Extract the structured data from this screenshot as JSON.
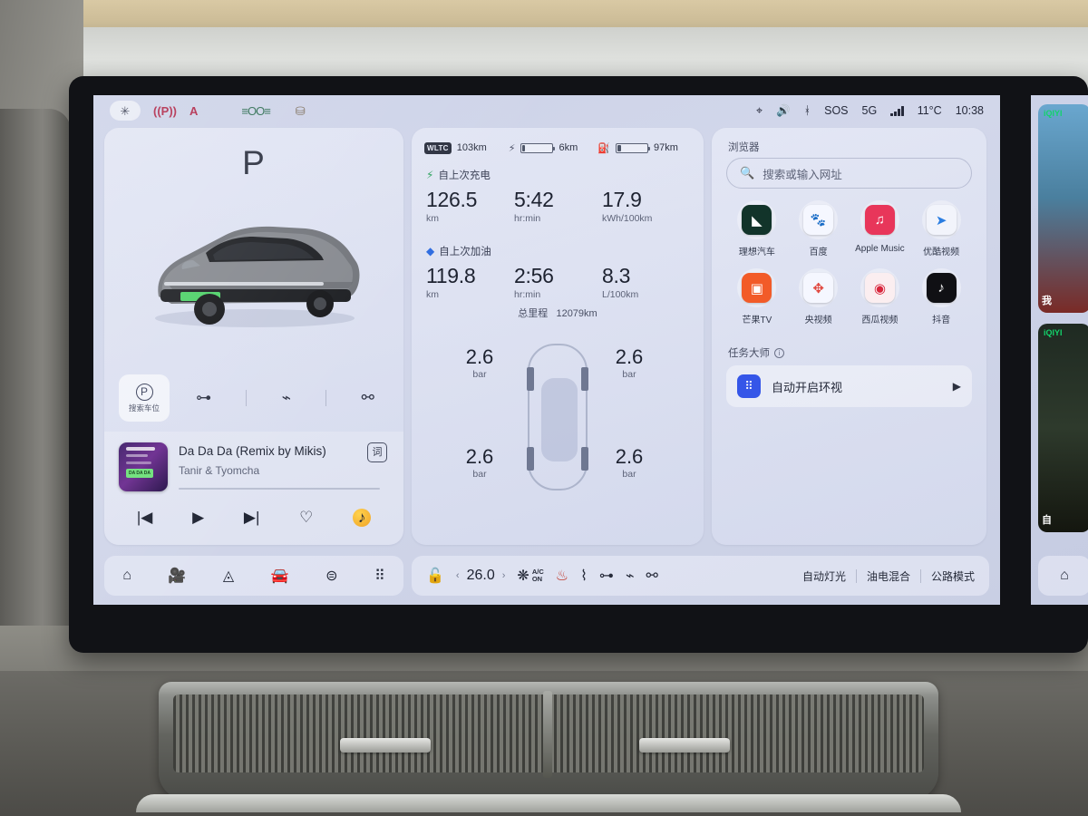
{
  "statusbar": {
    "left_icons": [
      {
        "name": "star-settings-icon",
        "glyph": "✳"
      },
      {
        "name": "parking-brake-icon",
        "glyph": "((P))"
      },
      {
        "name": "airbag-warning-icon",
        "glyph": "A"
      },
      {
        "name": "airbag-text-icon",
        "glyph": "▩"
      },
      {
        "name": "headlight-icon",
        "glyph": "≡OO≡"
      },
      {
        "name": "wiper-fluid-icon",
        "glyph": "⛁"
      }
    ],
    "right": {
      "location_icon": "location-pin-icon",
      "volume_icon": "speaker-icon",
      "bluetooth_icon": "bluetooth-icon",
      "sos_label": "SOS",
      "network_label": "5G",
      "temperature": "11°C",
      "clock": "10:38"
    }
  },
  "drive_card": {
    "gear": "P",
    "park_button": {
      "icon_label": "P",
      "label": "搜索车位"
    },
    "quick_actions": [
      {
        "name": "trunk-icon",
        "glyph": "⊃•"
      },
      {
        "name": "frunk-icon",
        "glyph": "⌒"
      },
      {
        "name": "charge-port-icon",
        "glyph": "⌁"
      }
    ],
    "media": {
      "title": "Da Da Da (Remix by Mikis)",
      "artist": "Tanir & Tyomcha",
      "album_text": "DA DA DA",
      "lyrics_button": "词",
      "controls": [
        {
          "name": "previous-track-button",
          "glyph": "◀◀"
        },
        {
          "name": "play-button",
          "glyph": "▶"
        },
        {
          "name": "next-track-button",
          "glyph": "▶▶"
        },
        {
          "name": "favorite-button",
          "glyph": "♡"
        },
        {
          "name": "music-source-button",
          "glyph": "♪"
        }
      ]
    }
  },
  "stats_card": {
    "range": {
      "wltc_badge": "WLTC",
      "wltc_value": "103km",
      "battery_value": "6km",
      "fuel_value": "97km"
    },
    "since_charge": {
      "label": "自上次充电",
      "distance": "126.5",
      "distance_unit": "km",
      "time": "5:42",
      "time_unit": "hr:min",
      "consumption": "17.9",
      "consumption_unit": "kWh/100km"
    },
    "since_refuel": {
      "label": "自上次加油",
      "distance": "119.8",
      "distance_unit": "km",
      "time": "2:56",
      "time_unit": "hr:min",
      "consumption": "8.3",
      "consumption_unit": "L/100km"
    },
    "odometer": {
      "label": "总里程",
      "value": "12079km"
    },
    "tire_pressure": {
      "unit": "bar",
      "front_left": "2.6",
      "front_right": "2.6",
      "rear_left": "2.6",
      "rear_right": "2.6"
    }
  },
  "browser_card": {
    "title": "浏览器",
    "search_placeholder": "搜索或输入网址",
    "apps": [
      {
        "label": "理想汽车",
        "icon_name": "li-auto-icon",
        "glyph": "◣",
        "bg": "#12342a"
      },
      {
        "label": "百度",
        "icon_name": "baidu-icon",
        "glyph": "🐾",
        "bg": "#f5f7ff"
      },
      {
        "label": "Apple Music",
        "icon_name": "apple-music-icon",
        "glyph": "♫",
        "bg": "#e8365a"
      },
      {
        "label": "优酷视频",
        "icon_name": "youku-icon",
        "glyph": "➤",
        "bg": "#f2f4fb"
      },
      {
        "label": "芒果TV",
        "icon_name": "mango-tv-icon",
        "glyph": "▣",
        "bg": "#f25b28"
      },
      {
        "label": "央视频",
        "icon_name": "cctv-video-icon",
        "glyph": "✥",
        "bg": "#f5f7ff"
      },
      {
        "label": "西瓜视频",
        "icon_name": "xigua-video-icon",
        "glyph": "◉",
        "bg": "#f7eaea"
      },
      {
        "label": "抖音",
        "icon_name": "douyin-icon",
        "glyph": "♪",
        "bg": "#101014"
      }
    ],
    "task_master": {
      "title": "任务大师",
      "task_label": "自动开启环视",
      "play_glyph": "▶"
    }
  },
  "dock": {
    "left_icons": [
      {
        "name": "home-icon",
        "glyph": "⌂"
      },
      {
        "name": "dashcam-icon",
        "glyph": "▭"
      },
      {
        "name": "navigation-icon",
        "glyph": "◬"
      },
      {
        "name": "vehicle-icon",
        "glyph": "⛊"
      },
      {
        "name": "settings-sliders-icon",
        "glyph": "⊟"
      },
      {
        "name": "all-apps-icon",
        "glyph": "⠿"
      }
    ],
    "climate": {
      "lock_icon": "unlock-icon",
      "temp_down": "‹",
      "temperature": "26.0",
      "temp_up": "›",
      "fan_icon": "fan-icon",
      "ac_line1": "A/C",
      "ac_line2": "ON",
      "seat_heat_icon": "heated-seat-icon",
      "defrost_icon": "rear-defrost-icon",
      "trunk_icon": "trunk-icon",
      "frunk_icon": "frunk-icon",
      "charge_icon": "charge-port-icon"
    },
    "modes": [
      {
        "label": "自动灯光"
      },
      {
        "label": "油电混合"
      },
      {
        "label": "公路模式"
      }
    ]
  },
  "passenger_screen": {
    "cards": [
      {
        "badge": "iQIYI",
        "tag": "我"
      },
      {
        "badge": "iQIYI",
        "tag": "自"
      }
    ],
    "home_icon": "home-icon"
  },
  "colors": {
    "accent_blue": "#3556e8",
    "screen_bg": "#ccd2e8",
    "text_primary": "#1d2230",
    "text_secondary": "#5d6378",
    "warn_red": "#b0294a",
    "green": "#2fa35f"
  }
}
